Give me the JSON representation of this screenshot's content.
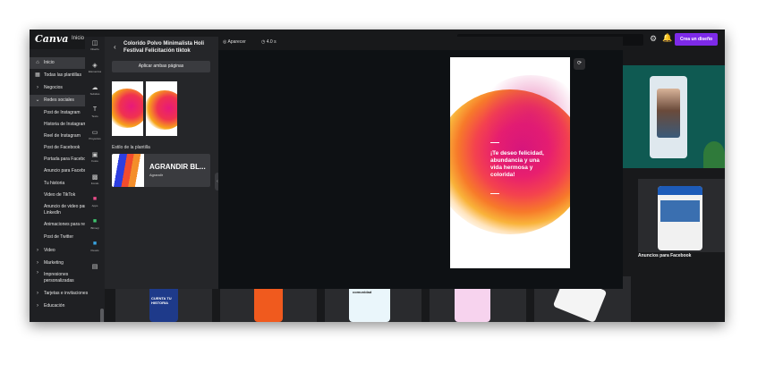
{
  "app": {
    "logo": "Canva",
    "top_home": "Inicio",
    "create_button": "Crea un diseño"
  },
  "sidebar": {
    "items": [
      {
        "label": "Inicio",
        "icon": "home-icon",
        "active": true
      },
      {
        "label": "Todas las plantillas",
        "icon": "grid-icon"
      },
      {
        "label": "Negocios",
        "icon": "chevron-right-icon"
      },
      {
        "label": "Redes sociales",
        "icon": "chevron-down-icon"
      },
      {
        "label": "Post de Instagram"
      },
      {
        "label": "Historia de Instagram"
      },
      {
        "label": "Reel de Instagram"
      },
      {
        "label": "Post de Facebook"
      },
      {
        "label": "Portada para Facebook"
      },
      {
        "label": "Anuncio para Facebook"
      },
      {
        "label": "Tu historia"
      },
      {
        "label": "Video de TikTok"
      },
      {
        "label": "Anuncio de video para LinkedIn"
      },
      {
        "label": "Animaciones para redes"
      },
      {
        "label": "Post de Twitter"
      },
      {
        "label": "Video",
        "icon": "chevron-right-icon"
      },
      {
        "label": "Marketing",
        "icon": "chevron-right-icon"
      },
      {
        "label": "Impresiones personalizadas",
        "icon": "chevron-right-icon"
      },
      {
        "label": "Tarjetas e invitaciones",
        "icon": "chevron-right-icon"
      },
      {
        "label": "Educación",
        "icon": "chevron-right-icon"
      }
    ]
  },
  "rail": {
    "items": [
      {
        "label": "Diseño",
        "icon": "layout-icon"
      },
      {
        "label": "Elementos",
        "icon": "shapes-icon"
      },
      {
        "label": "Subidos",
        "icon": "cloud-upload-icon"
      },
      {
        "label": "Texto",
        "icon": "text-icon"
      },
      {
        "label": "Proyectos",
        "icon": "folder-icon"
      },
      {
        "label": "Fotos",
        "icon": "image-icon"
      },
      {
        "label": "Fondo",
        "icon": "pattern-icon"
      },
      {
        "label": "Apps",
        "icon": "apps-icon"
      },
      {
        "label": "Bitmoji",
        "icon": "bitmoji-icon"
      },
      {
        "label": "Pexels",
        "icon": "pexels-icon"
      },
      {
        "label": "",
        "icon": "more-icon"
      }
    ]
  },
  "panel": {
    "title": "Colorido Polvo Minimalista Holi Festival Felicitación tiktok",
    "apply_button": "Aplicar ambas páginas",
    "style_label": "Estilo de la plantilla",
    "style_name": "AGRANDIR BL...",
    "style_sub": "Agrandir"
  },
  "editor": {
    "animate": "Aparecer",
    "duration": "4.0 s",
    "canvas_text": "¡Te deseo felicidad, abundancia y una vida hermosa y colorida!"
  },
  "background": {
    "facebook_ads_label": "Anuncios para Facebook",
    "card_crea": "Crea tu comunidad",
    "card_cuenta": "CUENTA TU HISTORIA"
  },
  "colors": {
    "accent": "#7d2ae8",
    "bg_dark": "#18191b"
  }
}
